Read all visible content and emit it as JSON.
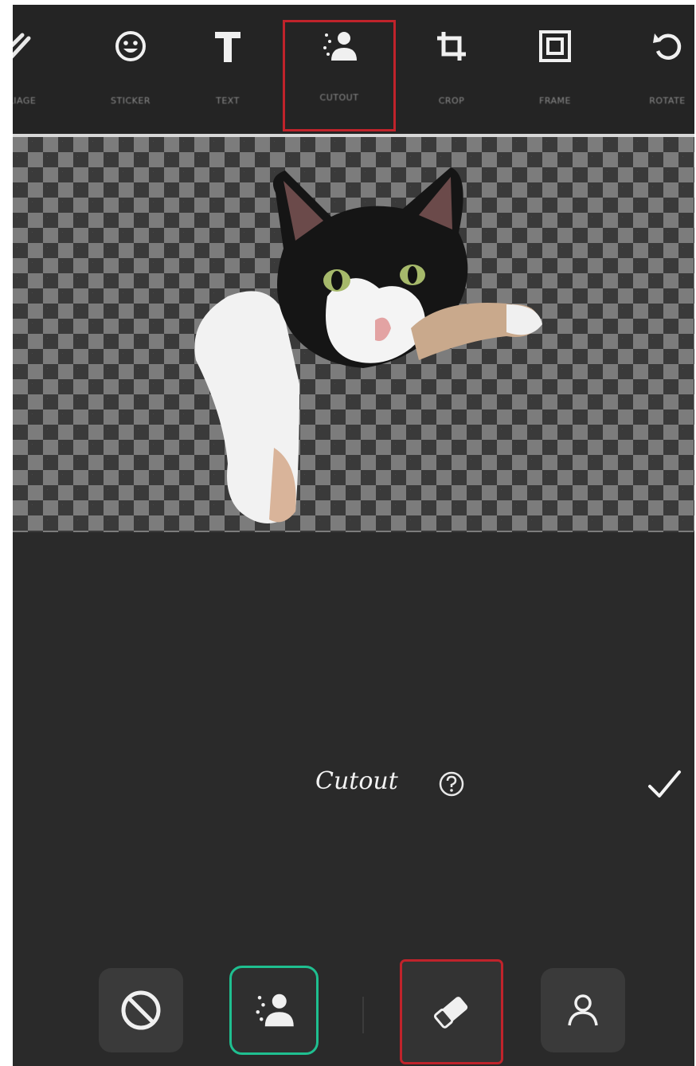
{
  "toolbar": {
    "items": [
      {
        "label": "FOLIAGE",
        "icon": "brush-icon"
      },
      {
        "label": "STICKER",
        "icon": "smiley-icon"
      },
      {
        "label": "TEXT",
        "icon": "text-icon"
      },
      {
        "label": "CUTOUT",
        "icon": "cutout-person-icon",
        "selected": true
      },
      {
        "label": "CROP",
        "icon": "crop-icon"
      },
      {
        "label": "FRAME",
        "icon": "frame-icon"
      },
      {
        "label": "ROTATE",
        "icon": "rotate-icon"
      }
    ]
  },
  "panel": {
    "title": "Cutout",
    "help_icon": "help-circle-icon",
    "confirm_icon": "checkmark-icon"
  },
  "bottom_tools": [
    {
      "name": "none",
      "icon": "prohibit-icon"
    },
    {
      "name": "auto-cutout",
      "icon": "cutout-person-icon",
      "active": true
    },
    {
      "name": "eraser",
      "icon": "eraser-icon",
      "highlighted": true
    },
    {
      "name": "person",
      "icon": "person-outline-icon"
    }
  ],
  "colors": {
    "background": "#2a2a2a",
    "toolbar": "#242424",
    "active_border": "#1fbf90",
    "highlight_red": "#c0232b",
    "label_gray": "#8c8c8c"
  }
}
